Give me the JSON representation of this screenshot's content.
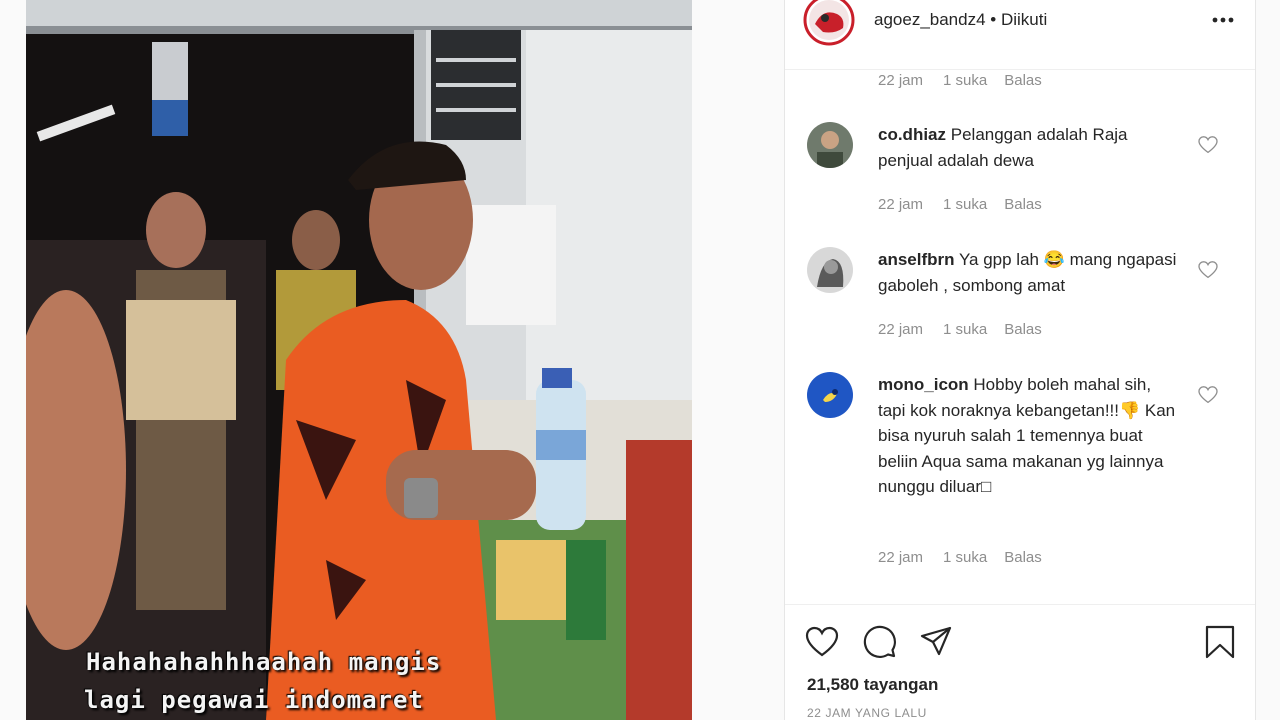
{
  "post": {
    "username": "agoez_bandz4",
    "follow_status": "Diikuti",
    "separator": "•",
    "more_icon": "more-horizontal-icon"
  },
  "video": {
    "caption_line1": "Hahahahahhhaahah mangis",
    "caption_line2": "lagi pegawai indomaret"
  },
  "comments": [
    {
      "username": "",
      "text": "",
      "time": "22 jam",
      "likes": "1 suka",
      "reply": "Balas"
    },
    {
      "username": "co.dhiaz",
      "text": "Pelanggan adalah Raja penjual adalah dewa",
      "time": "22 jam",
      "likes": "1 suka",
      "reply": "Balas"
    },
    {
      "username": "anselfbrn",
      "text": "Ya gpp lah 😂 mang ngapasi gaboleh , sombong amat",
      "time": "22 jam",
      "likes": "1 suka",
      "reply": "Balas"
    },
    {
      "username": "mono_icon",
      "text": "Hobby boleh mahal sih, tapi kok noraknya kebangetan!!!👎 Kan bisa nyuruh salah 1 temennya buat beliin Aqua sama makanan yg lainnya nunggu diluar□",
      "time": "22 jam",
      "likes": "1 suka",
      "reply": "Balas"
    }
  ],
  "actions": {
    "like_icon": "heart-icon",
    "comment_icon": "comment-icon",
    "share_icon": "send-icon",
    "save_icon": "bookmark-icon",
    "views": "21,580 tayangan",
    "time_ago": "22 JAM YANG LALU"
  }
}
